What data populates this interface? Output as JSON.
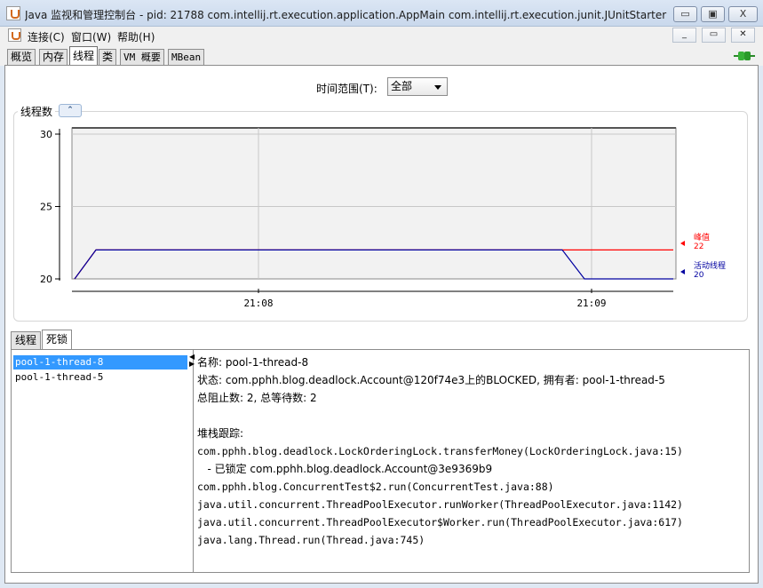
{
  "window": {
    "title": "Java 监视和管理控制台 - pid: 21788 com.intellij.rt.execution.application.AppMain com.intellij.rt.execution.junit.JUnitStarter -ide...",
    "min": "▭",
    "max": "▣",
    "close": "X"
  },
  "menu": {
    "items": [
      "连接(C)",
      "窗口(W)",
      "帮助(H)"
    ],
    "inner_min": "_",
    "inner_restore": "▭",
    "inner_close": "✕"
  },
  "tabs": [
    "概览",
    "内存",
    "线程",
    "类",
    "VM 概要",
    "MBean"
  ],
  "active_tab": "线程",
  "time_range": {
    "label": "时间范围(T):",
    "value": "全部"
  },
  "chart_data": {
    "type": "line",
    "title": "线程数",
    "x_ticks": [
      "21:08",
      "21:09"
    ],
    "y_ticks": [
      20,
      25,
      30
    ],
    "ylim": [
      20,
      30
    ],
    "series": [
      {
        "name": "峰值",
        "color": "#ff0000",
        "latest": "22",
        "values": [
          20,
          22,
          22,
          22,
          22
        ]
      },
      {
        "name": "活动线程",
        "color": "#0000a0",
        "latest": "20",
        "values": [
          20,
          22,
          22,
          22,
          20
        ]
      }
    ]
  },
  "subtabs": [
    "线程",
    "死锁"
  ],
  "threads": [
    "pool-1-thread-8",
    "pool-1-thread-5"
  ],
  "detail": {
    "name": "名称: pool-1-thread-8",
    "state": "状态: com.pphh.blog.deadlock.Account@120f74e3上的BLOCKED, 拥有者: pool-1-thread-5",
    "counts": "总阻止数: 2, 总等待数: 2",
    "stack_label": "堆栈跟踪:",
    "stack": [
      "com.pphh.blog.deadlock.LockOrderingLock.transferMoney(LockOrderingLock.java:15)",
      "   - 已锁定 com.pphh.blog.deadlock.Account@3e9369b9",
      "com.pphh.blog.ConcurrentTest$2.run(ConcurrentTest.java:88)",
      "java.util.concurrent.ThreadPoolExecutor.runWorker(ThreadPoolExecutor.java:1142)",
      "java.util.concurrent.ThreadPoolExecutor$Worker.run(ThreadPoolExecutor.java:617)",
      "java.lang.Thread.run(Thread.java:745)"
    ]
  }
}
